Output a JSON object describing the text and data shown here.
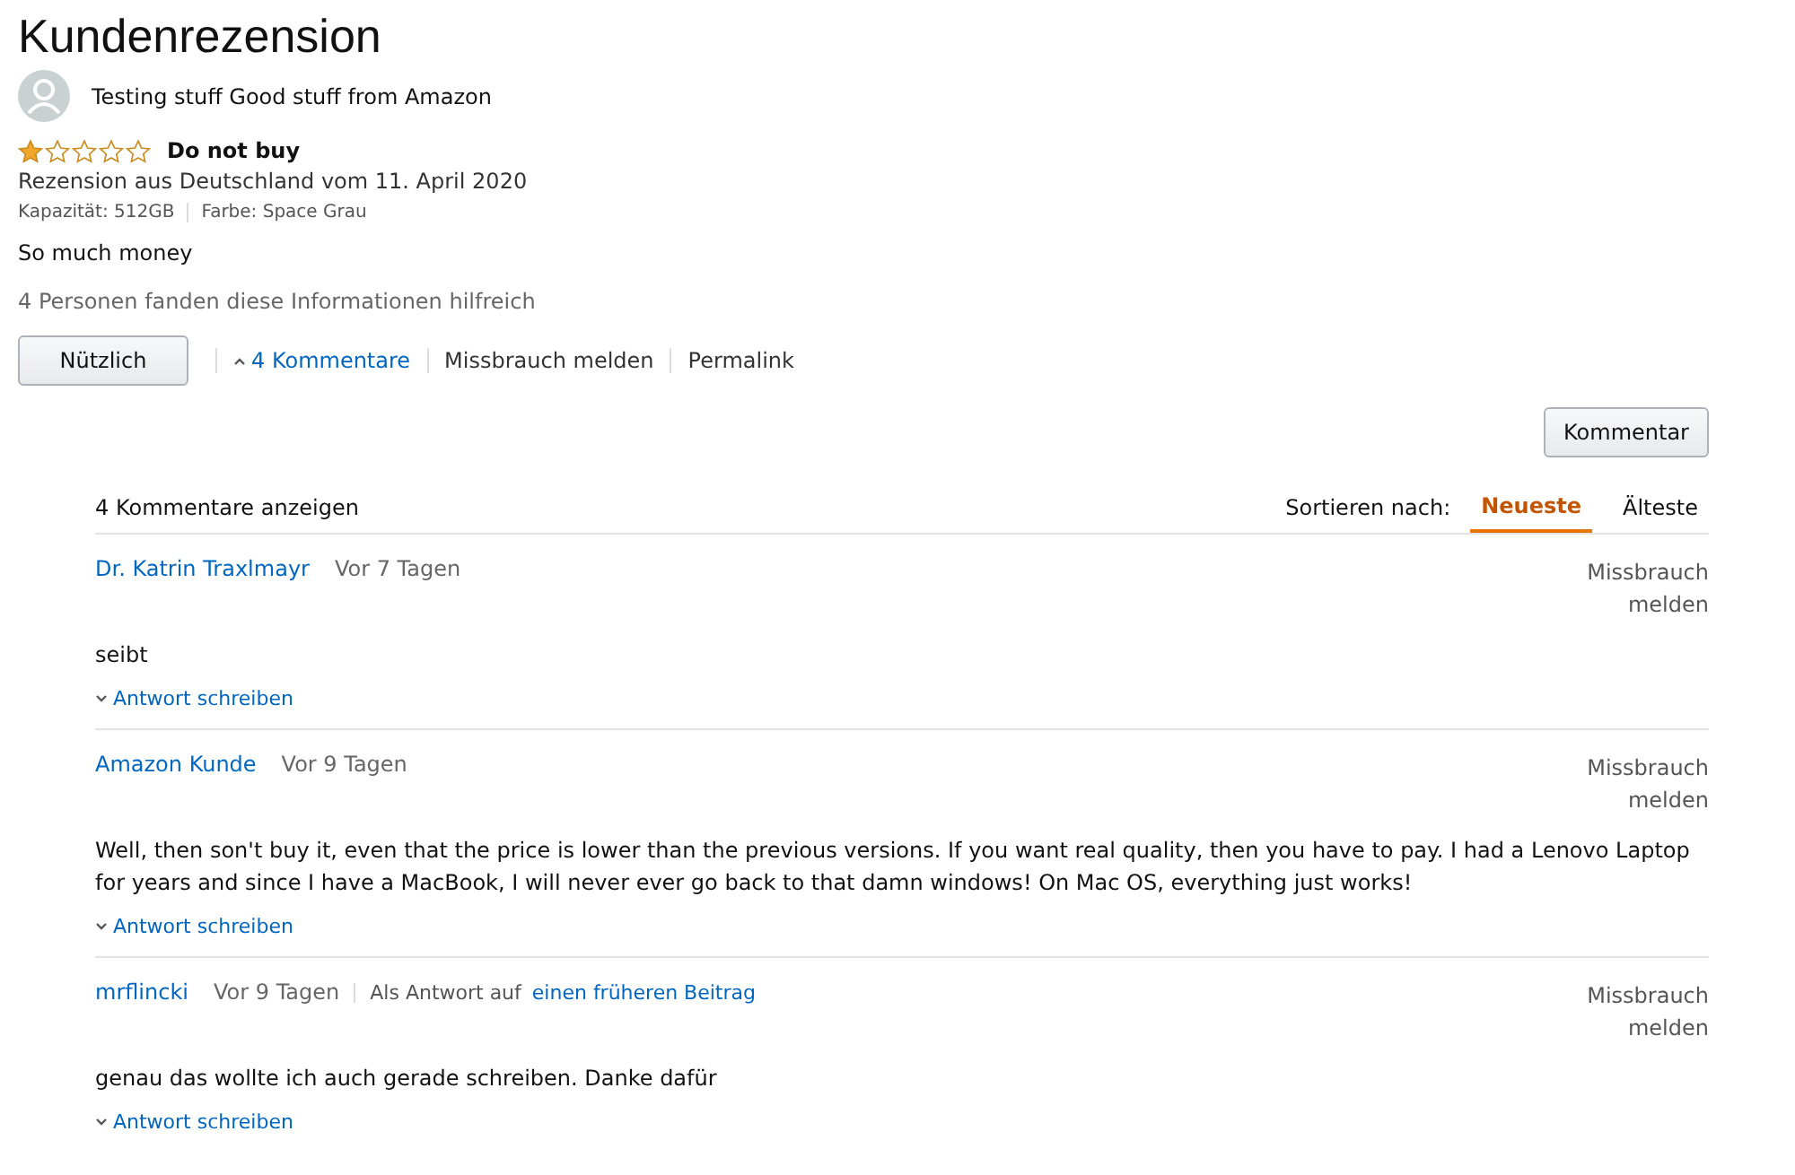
{
  "title": "Kundenrezension",
  "reviewer": "Testing stuff Good stuff from Amazon",
  "review": {
    "stars": 1,
    "headline": "Do not buy",
    "date": "Rezension aus Deutschland vom 11. April 2020",
    "attributes": [
      "Kapazität: 512GB",
      "Farbe: Space Grau"
    ],
    "body": "So much money",
    "helpful_text": "4 Personen fanden diese Informationen hilfreich"
  },
  "actions": {
    "helpful_button": "Nützlich",
    "comments_link": "4 Kommentare",
    "report": "Missbrauch melden",
    "permalink": "Permalink"
  },
  "comment_button": "Kommentar",
  "comments": {
    "heading": "4 Kommentare anzeigen",
    "sort_label": "Sortieren nach:",
    "sort_options": [
      {
        "label": "Neueste",
        "selected": true
      },
      {
        "label": "Älteste",
        "selected": false
      }
    ],
    "items": [
      {
        "author": "Dr. Katrin Traxlmayr",
        "age": "Vor 7 Tagen",
        "body": "seibt",
        "report": "Missbrauch melden",
        "reply": "Antwort schreiben"
      },
      {
        "author": "Amazon Kunde",
        "age": "Vor 9 Tagen",
        "body": "Well, then son't buy it, even that the price is lower than the previous versions. If you want real quality, then you have to pay. I had a Lenovo Laptop for years and since I have a MacBook, I will never ever go back to that damn windows! On Mac OS, everything just works!",
        "report": "Missbrauch melden",
        "reply": "Antwort schreiben"
      },
      {
        "author": "mrflincki",
        "age": "Vor 9 Tagen",
        "in_reply_label": "Als Antwort auf",
        "in_reply_link": "einen früheren Beitrag",
        "body": "genau das wollte ich auch gerade schreiben. Danke dafür",
        "report": "Missbrauch melden",
        "reply": "Antwort schreiben"
      }
    ]
  }
}
